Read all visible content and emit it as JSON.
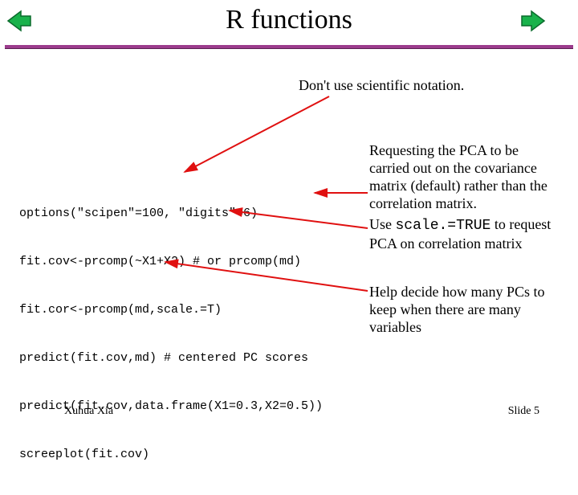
{
  "title": "R functions",
  "note_scipen": "Don't use scientific notation.",
  "code": {
    "l1": "options(\"scipen\"=100, \"digits\"=6)",
    "l2": "fit.cov<-prcomp(~X1+X2) # or prcomp(md)",
    "l3": "fit.cor<-prcomp(md,scale.=T)",
    "l4": "predict(fit.cov,md) # centered PC scores",
    "l5": "predict(fit.cov,data.frame(X1=0.3,X2=0.5))",
    "l6": "screeplot(fit.cov)"
  },
  "notes": {
    "pca_cov_1": "Requesting the PCA to be carried out on the covariance matrix (default) rather than the correlation matrix.",
    "pca_cor_prefix": "Use ",
    "pca_cor_code": "scale.=TRUE",
    "pca_cor_suffix": " to request PCA on correlation matrix",
    "help": "Help decide how many PCs to keep when there are many variables"
  },
  "footer": {
    "author": "Xuhua Xia",
    "slide": "Slide 5"
  }
}
